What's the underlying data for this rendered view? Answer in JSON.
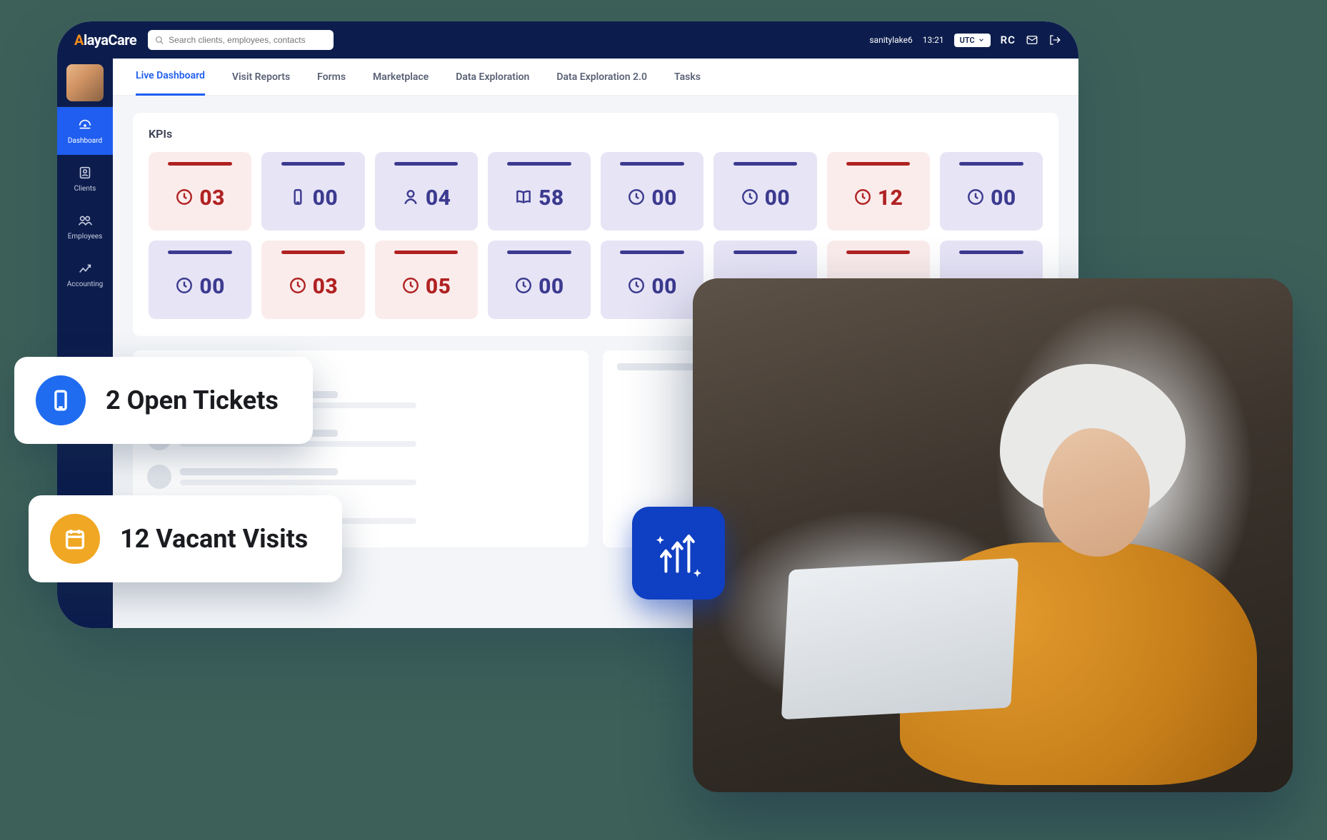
{
  "brand": {
    "name": "AlayaCare"
  },
  "search": {
    "placeholder": "Search clients, employees, contacts"
  },
  "header": {
    "org": "sanitylake6",
    "time": "13:21",
    "tz": "UTC",
    "initials": "RC"
  },
  "sidenav": [
    {
      "label": "Dashboard",
      "icon": "dashboard",
      "active": true
    },
    {
      "label": "Clients",
      "icon": "client",
      "active": false
    },
    {
      "label": "Employees",
      "icon": "employees",
      "active": false
    },
    {
      "label": "Accounting",
      "icon": "accounting",
      "active": false
    }
  ],
  "tabs": [
    {
      "label": "Live Dashboard",
      "active": true
    },
    {
      "label": "Visit Reports",
      "active": false
    },
    {
      "label": "Forms",
      "active": false
    },
    {
      "label": "Marketplace",
      "active": false
    },
    {
      "label": "Data Exploration",
      "active": false
    },
    {
      "label": "Data Exploration 2.0",
      "active": false
    },
    {
      "label": "Tasks",
      "active": false
    }
  ],
  "kpis": {
    "title": "KPIs",
    "cards": [
      {
        "color": "red",
        "icon": "clock",
        "value": "03"
      },
      {
        "color": "purple",
        "icon": "phone",
        "value": "00"
      },
      {
        "color": "purple",
        "icon": "person",
        "value": "04"
      },
      {
        "color": "purple",
        "icon": "book",
        "value": "58"
      },
      {
        "color": "purple",
        "icon": "clock",
        "value": "00"
      },
      {
        "color": "purple",
        "icon": "clock",
        "value": "00"
      },
      {
        "color": "red",
        "icon": "clock",
        "value": "12"
      },
      {
        "color": "purple",
        "icon": "clock",
        "value": "00"
      },
      {
        "color": "purple",
        "icon": "clock",
        "value": "00"
      },
      {
        "color": "red",
        "icon": "clock",
        "value": "03"
      },
      {
        "color": "red",
        "icon": "clock",
        "value": "05"
      },
      {
        "color": "purple",
        "icon": "clock",
        "value": "00"
      },
      {
        "color": "purple",
        "icon": "clock",
        "value": "00"
      },
      {
        "color": "purple",
        "icon": "",
        "value": ""
      },
      {
        "color": "red",
        "icon": "",
        "value": ""
      },
      {
        "color": "purple",
        "icon": "",
        "value": ""
      }
    ]
  },
  "callouts": {
    "tickets": "2 Open Tickets",
    "visits": "12 Vacant Visits"
  }
}
